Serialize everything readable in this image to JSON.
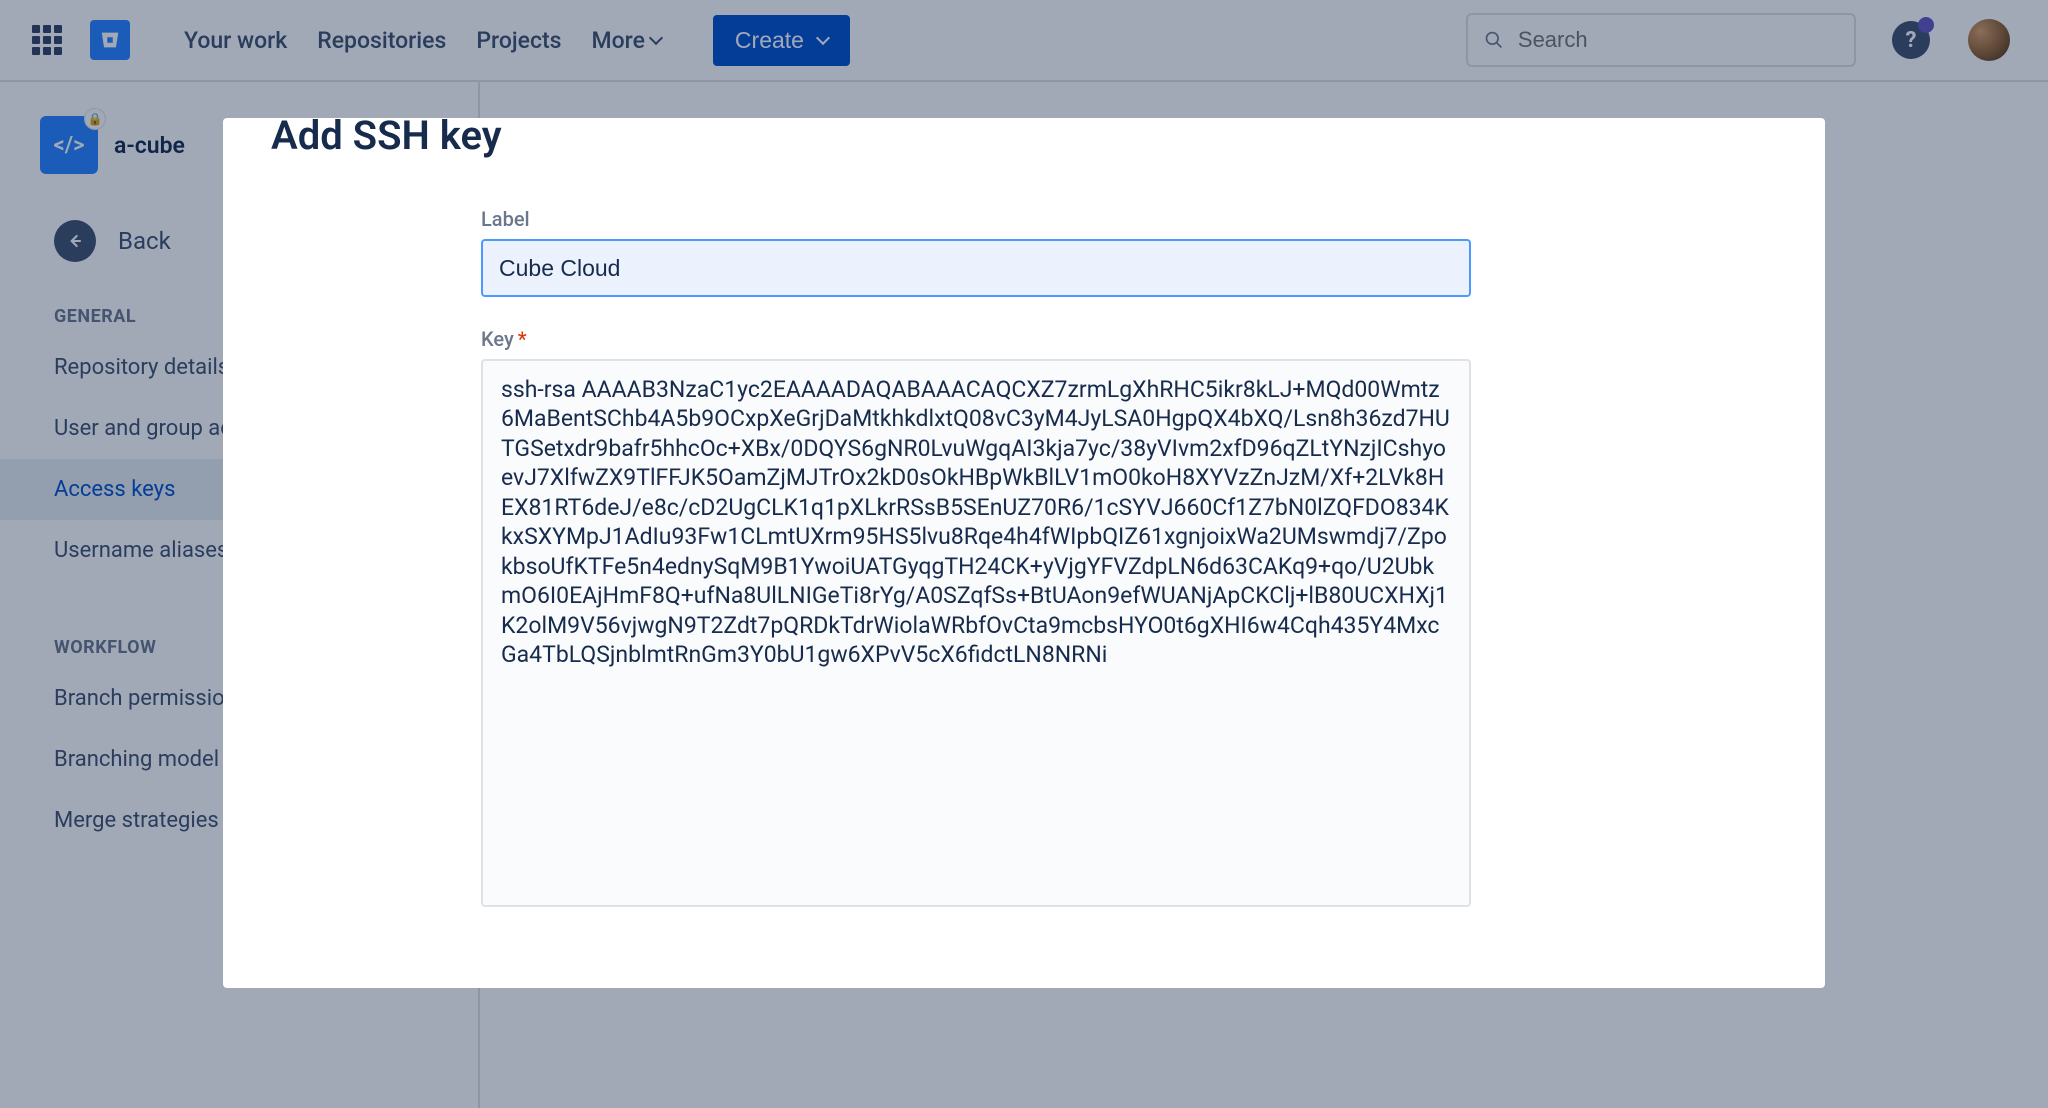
{
  "nav": {
    "links": {
      "your_work": "Your work",
      "repositories": "Repositories",
      "projects": "Projects",
      "more": "More"
    },
    "create": "Create",
    "search_placeholder": "Search"
  },
  "sidebar": {
    "repo_name": "a-cube",
    "back": "Back",
    "sections": {
      "general": {
        "title": "GENERAL",
        "items": [
          "Repository details",
          "User and group access",
          "Access keys",
          "Username aliases"
        ],
        "active_index": 2
      },
      "workflow": {
        "title": "WORKFLOW",
        "items": [
          "Branch permissions",
          "Branching model",
          "Merge strategies"
        ]
      }
    }
  },
  "modal": {
    "title": "Add SSH key",
    "label_field_label": "Label",
    "label_value": "Cube Cloud",
    "key_field_label": "Key",
    "key_value": "ssh-rsa AAAAB3NzaC1yc2EAAAADAQABAAACAQCXZ7zrmLgXhRHC5ikr8kLJ+MQd00Wmtz6MaBentSChb4A5b9OCxpXeGrjDaMtkhkdlxtQ08vC3yM4JyLSA0HgpQX4bXQ/Lsn8h36zd7HUTGSetxdr9bafr5hhcOc+XBx/0DQYS6gNR0LvuWgqAI3kja7yc/38yVIvm2xfD96qZLtYNzjICshyoevJ7XlfwZX9TlFFJK5OamZjMJTrOx2kD0sOkHBpWkBlLV1mO0koH8XYVzZnJzM/Xf+2LVk8HEX81RT6deJ/e8c/cD2UgCLK1q1pXLkrRSsB5SEnUZ70R6/1cSYVJ660Cf1Z7bN0lZQFDO834KkxSXYMpJ1AdIu93Fw1CLmtUXrm95HS5lvu8Rqe4h4fWIpbQIZ61xgnjoixWa2UMswmdj7/ZpokbsoUfKTFe5n4ednySqM9B1YwoiUATGyqgTH24CK+yVjgYFVZdpLN6d63CAKq9+qo/U2UbkmO6I0EAjHmF8Q+ufNa8UlLNIGeTi8rYg/A0SZqfSs+BtUAon9efWUANjApCKClj+lB80UCXHXj1K2olM9V56vjwgN9T2Zdt7pQRDkTdrWiolaWRbfOvCta9mcbsHYO0t6gXHI6w4Cqh435Y4MxcGa4TbLQSjnblmtRnGm3Y0bU1gw6XPvV5cX6fidctLN8NRNi"
  }
}
